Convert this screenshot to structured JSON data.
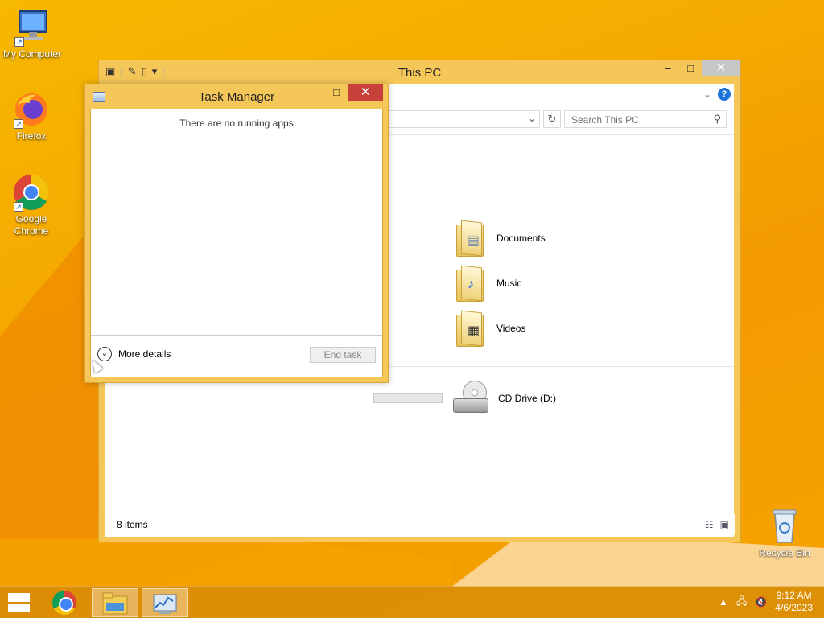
{
  "desktop": {
    "icons": [
      {
        "label": "My Computer"
      },
      {
        "label": "Firefox"
      },
      {
        "label": "Google Chrome"
      },
      {
        "label": "Recycle Bin"
      }
    ]
  },
  "explorer": {
    "title": "This PC",
    "search_placeholder": "Search This PC",
    "folders": [
      {
        "label": "Documents"
      },
      {
        "label": "Music"
      },
      {
        "label": "Videos"
      }
    ],
    "drives": [
      {
        "label": "CD Drive (D:)"
      }
    ],
    "status": "8 items",
    "icons": {
      "help": "?",
      "refresh": "↻",
      "dropdown": "⌄",
      "search": "⚲"
    }
  },
  "taskmgr": {
    "title": "Task Manager",
    "message": "There are no running apps",
    "more_details": "More details",
    "end_task": "End task"
  },
  "taskbar": {
    "time": "9:12 AM",
    "date": "4/6/2023"
  },
  "colors": {
    "accent": "#f5c658",
    "close_red": "#c7403a",
    "wallpaper": "#f5a800"
  }
}
